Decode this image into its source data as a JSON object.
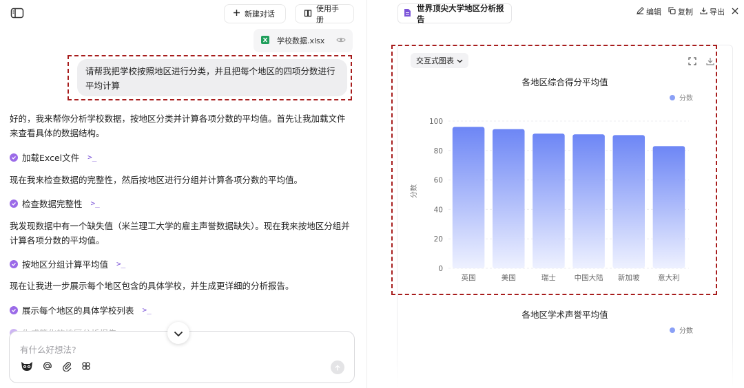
{
  "header": {
    "new_chat": "新建对话",
    "manual": "使用手册"
  },
  "file": {
    "name": "学校数据.xlsx"
  },
  "user_message": "请帮我把学校按照地区进行分类，并且把每个地区的四项分数进行平均计算",
  "assistant": {
    "para1": "好的，我来帮你分析学校数据，按地区分类并计算各项分数的平均值。首先让我加载文件来查看具体的数据结构。",
    "step1": "加载Excel文件",
    "para2": "现在我来检查数据的完整性，然后按地区进行分组并计算各项分数的平均值。",
    "step2": "检查数据完整性",
    "para3": "我发现数据中有一个缺失值（米兰理工大学的雇主声誉数据缺失）。现在我来按地区分组并计算各项分数的平均值。",
    "step3": "按地区分组计算平均值",
    "para4": "现在让我进一步展示每个地区包含的具体学校，并生成更详细的分析报告。",
    "step4": "展示每个地区的具体学校列表",
    "step5": "生成简化的地区分析报告",
    "term_symbol": ">_"
  },
  "input": {
    "placeholder": "有什么好想法?"
  },
  "report": {
    "title": "世界顶尖大学地区分析报告",
    "actions": {
      "edit": "编辑",
      "copy": "复制",
      "export": "导出"
    },
    "chart_mode": "交互式图表"
  },
  "chart_data": [
    {
      "type": "bar",
      "title": "各地区综合得分平均值",
      "categories": [
        "英国",
        "美国",
        "瑞士",
        "中国大陆",
        "新加坡",
        "意大利"
      ],
      "series": [
        {
          "name": "分数",
          "values": [
            96,
            94.5,
            91.5,
            91,
            90.5,
            83
          ]
        }
      ],
      "ylabel": "分数",
      "ylim": [
        0,
        100
      ],
      "yticks": [
        0,
        20,
        40,
        60,
        80,
        100
      ],
      "legend": "top-right",
      "grid": true,
      "colors": {
        "bar_top": "#6d86f5",
        "bar_bottom": "#eef1ff"
      }
    },
    {
      "type": "bar",
      "title": "各地区学术声誉平均值",
      "series": [
        {
          "name": "分数"
        }
      ]
    }
  ]
}
